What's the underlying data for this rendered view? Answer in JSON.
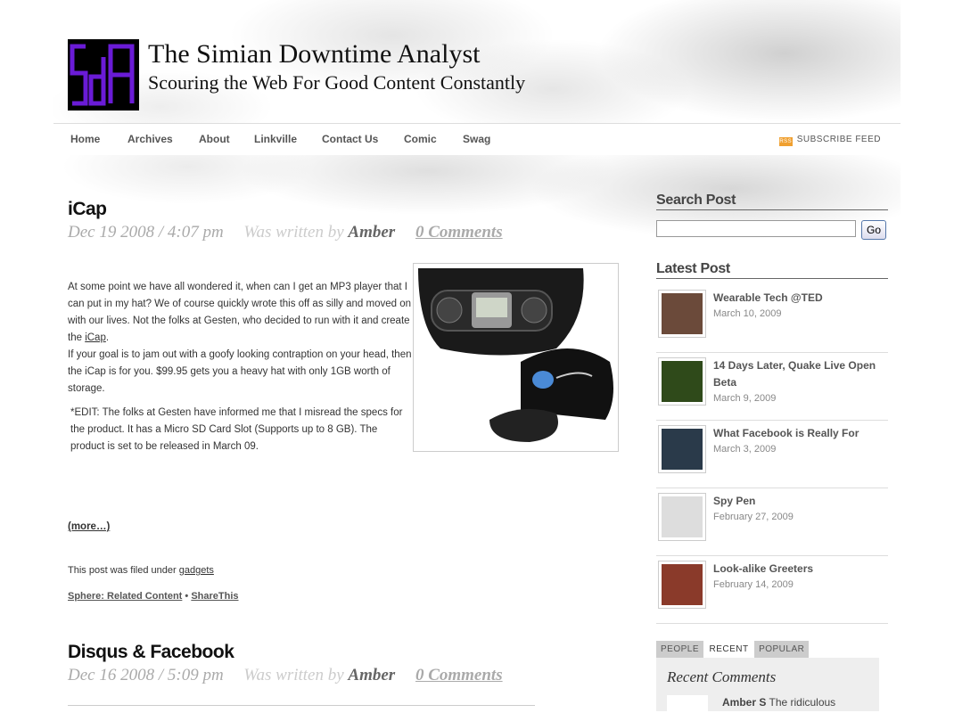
{
  "header": {
    "title": "The Simian Downtime Analyst",
    "tagline": "Scouring the Web For Good Content Constantly",
    "logo_text": "SdA",
    "logo_color": "#6a1bd6"
  },
  "nav": {
    "items": [
      "Home",
      "Archives",
      "About",
      "Linkville",
      "Contact Us",
      "Comic",
      "Swag"
    ],
    "rss_label": "SUBSCRIBE FEED",
    "rss_icon": "rss"
  },
  "posts": [
    {
      "title": "iCap",
      "date": "Dec 19 2008 / 4:07 pm",
      "written_by": "Was written by",
      "author": "Amber",
      "comments": "0 Comments",
      "body_p1_a": "At some point we have all wondered it, when can I get an MP3 player that I can put in my hat? We of course quickly wrote this off as silly and moved on with our lives. Not the folks at Gesten, who decided to run with it and create the ",
      "body_p1_link": "iCap",
      "body_p1_b": ".",
      "body_p2": "If your goal is to jam out with a goofy looking contraption on your head, then the iCap is for you. $99.95 gets you a heavy hat with only 1GB worth of storage.",
      "body_p3": "*EDIT: The folks at Gesten have informed me that I misread the specs for the product. It has a Micro SD Card Slot (Supports up to 8 GB). The product is set to be released in March 09.",
      "more": "(more…)",
      "filed_prefix": "This post was filed under ",
      "filed_category": "gadgets",
      "sphere": "Sphere: Related Content",
      "separator": " • ",
      "sharethis": "ShareThis"
    },
    {
      "title": "Disqus & Facebook",
      "date": "Dec 16 2008 / 5:09 pm",
      "written_by": "Was written by",
      "author": "Amber",
      "comments": "0 Comments"
    }
  ],
  "sidebar": {
    "search_heading": "Search Post",
    "search_button": "Go",
    "search_value": "",
    "latest_heading": "Latest Post",
    "latest": [
      {
        "title": "Wearable Tech @TED",
        "date": "March 10, 2009",
        "thumb_color": "#6b4a3a"
      },
      {
        "title": "14 Days Later, Quake Live Open Beta",
        "date": "March 9, 2009",
        "thumb_color": "#2f4a1a"
      },
      {
        "title": "What Facebook is Really For",
        "date": "March 3, 2009",
        "thumb_color": "#2a3a4a"
      },
      {
        "title": "Spy Pen",
        "date": "February 27, 2009",
        "thumb_color": "#dddddd"
      },
      {
        "title": "Look-alike Greeters",
        "date": "February 14, 2009",
        "thumb_color": "#8a3a2a"
      }
    ],
    "tabs": [
      "PEOPLE",
      "RECENT",
      "POPULAR"
    ],
    "active_tab": "RECENT",
    "recent_heading": "Recent Comments",
    "recent_comment_author": "Amber S",
    "recent_comment_text": "The ridiculous"
  }
}
